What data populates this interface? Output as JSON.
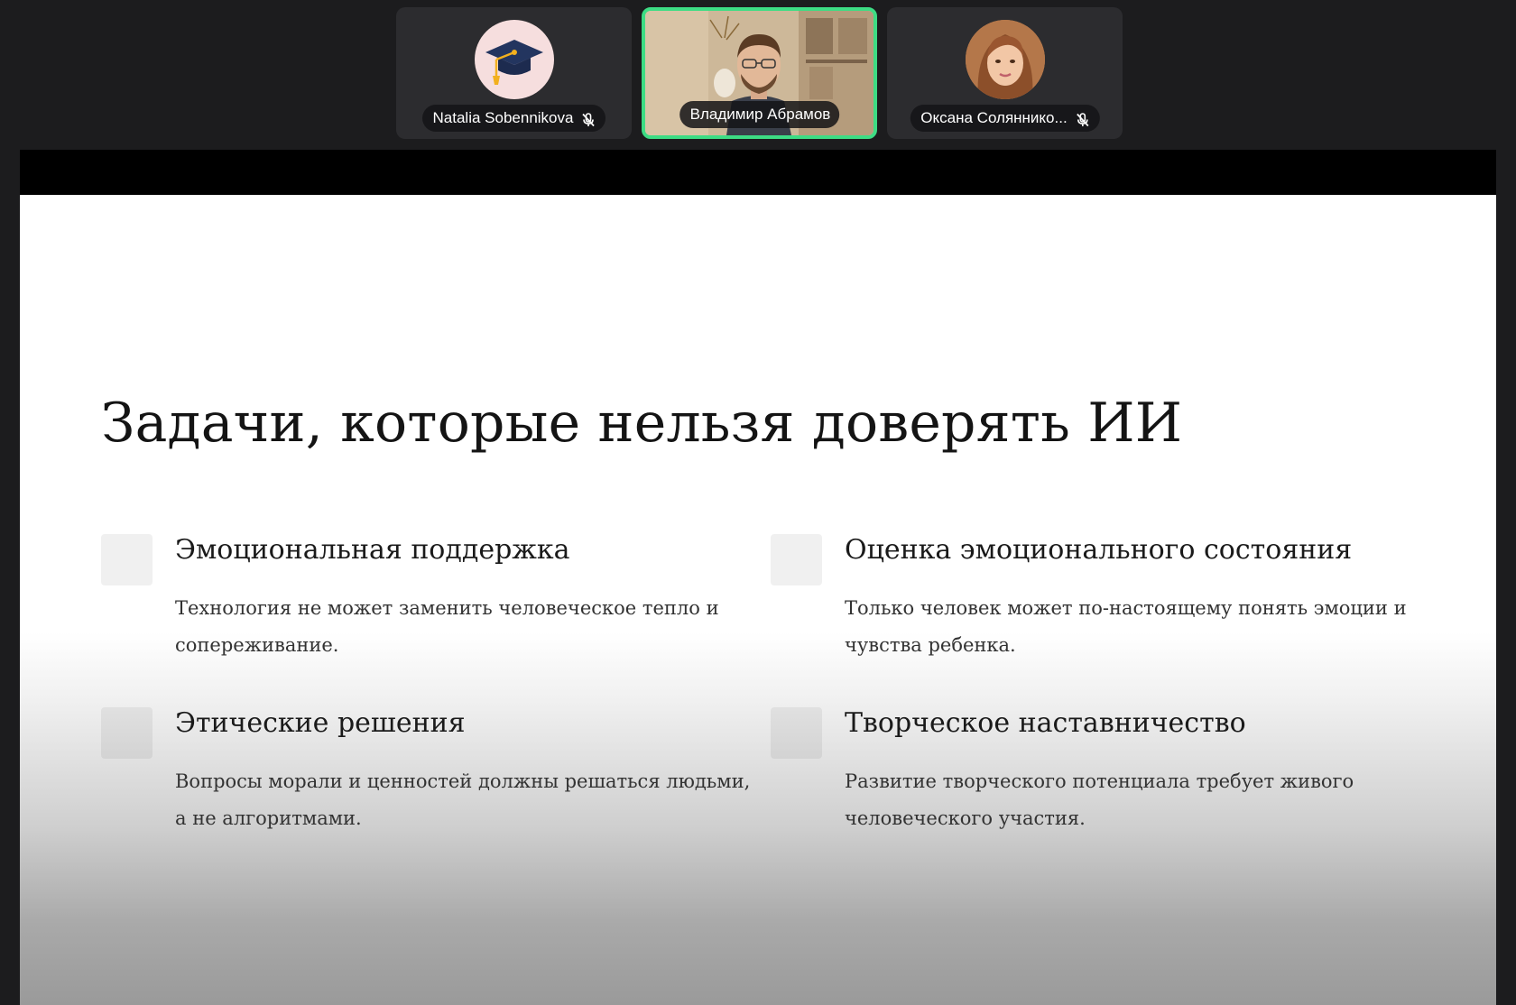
{
  "participants": [
    {
      "name": "Natalia Sobennikova",
      "avatar_icon": "graduation-cap-icon",
      "mic": "muted"
    },
    {
      "name": "Владимир Абрамов",
      "active_speaker": true,
      "video": "on"
    },
    {
      "name": "Оксана Соляннико...",
      "avatar_icon": "woman-avatar",
      "mic": "muted"
    }
  ],
  "colors": {
    "active_speaker_border": "#3ddc84",
    "background": "#1c1c1e"
  },
  "slide": {
    "title": "Задачи, которые нельзя доверять ИИ",
    "items": [
      {
        "title": "Эмоциональная поддержка",
        "desc": "Технология не может заменить человеческое тепло и сопереживание."
      },
      {
        "title": "Оценка эмоционального состояния",
        "desc": "Только человек может по-настоящему понять эмоции и чувства ребенка."
      },
      {
        "title": "Этические решения",
        "desc": "Вопросы морали и ценностей должны решаться людьми, а не алгоритмами."
      },
      {
        "title": "Творческое наставничество",
        "desc": "Развитие творческого потенциала требует живого человеческого участия."
      }
    ]
  }
}
